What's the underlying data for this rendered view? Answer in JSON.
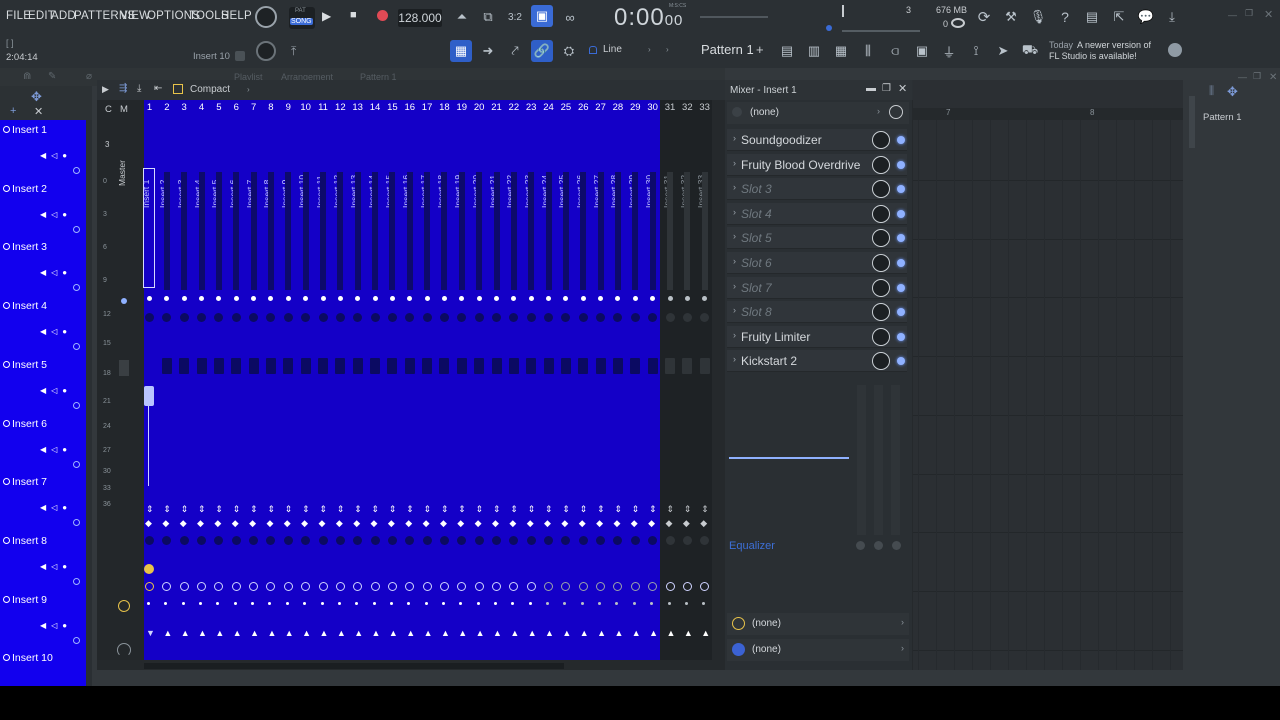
{
  "menu": [
    "FILE",
    "EDIT",
    "ADD",
    "PATTERNS",
    "VIEW",
    "OPTIONS",
    "TOOLS",
    "HELP"
  ],
  "transport": {
    "pat_label": "PAT",
    "song_label": "SONG",
    "tempo": "128.000",
    "time": "0:00",
    "time_frac": "00",
    "time_unit": "M:S:CS",
    "cpu_mem": "676 MB",
    "cpu_val": "3",
    "poly": "0",
    "position_hint": "2:04:14"
  },
  "toolbar": {
    "snap_label": "Line",
    "pattern_label": "Pattern 1",
    "pattern_add": "+",
    "news_date": "Today",
    "news_text": "A newer version of FL Studio is available!",
    "insert_hint": "Insert 10"
  },
  "playlist_tabs": {
    "playlist": "Playlist",
    "arrangement": "Arrangement",
    "pattern": "Pattern 1"
  },
  "inserts": [
    "Insert 1",
    "Insert 2",
    "Insert 3",
    "Insert 4",
    "Insert 5",
    "Insert 6",
    "Insert 7",
    "Insert 8",
    "Insert 9",
    "Insert 10"
  ],
  "mixer": {
    "view_mode": "Compact",
    "cm_labels": [
      "C",
      "M"
    ],
    "master_label": "Master",
    "master_num": "3",
    "channels": [
      "1",
      "2",
      "3",
      "4",
      "5",
      "6",
      "7",
      "8",
      "9",
      "10",
      "11",
      "12",
      "13",
      "14",
      "15",
      "16",
      "17",
      "18",
      "19",
      "20",
      "21",
      "22",
      "23",
      "24",
      "25",
      "26",
      "27",
      "28",
      "29",
      "30",
      "31",
      "32",
      "33"
    ],
    "channel_names": [
      "Insert 1",
      "Insert 2",
      "Insert 3",
      "Insert 4",
      "Insert 5",
      "Insert 6",
      "Insert 7",
      "Insert 8",
      "Insert 9",
      "Insert 10",
      "Insert 11",
      "Insert 12",
      "Insert 13",
      "Insert 14",
      "Insert 15",
      "Insert 16",
      "Insert 17",
      "Insert 18",
      "Insert 19",
      "Insert 20",
      "Insert 21",
      "Insert 22",
      "Insert 23",
      "Insert 24",
      "Insert 25",
      "Insert 26",
      "Insert 27",
      "Insert 28",
      "Insert 29",
      "Insert 30",
      "Insert 31",
      "Insert 32",
      "Insert 33"
    ],
    "db_scale": [
      "0",
      "3",
      "6",
      "9",
      "12",
      "15",
      "18",
      "21",
      "24",
      "27",
      "30",
      "33",
      "36"
    ]
  },
  "fx_panel": {
    "title": "Mixer - Insert 1",
    "input": "(none)",
    "slots": [
      {
        "name": "Soundgoodizer",
        "empty": false
      },
      {
        "name": "Fruity Blood Overdrive",
        "empty": false
      },
      {
        "name": "Slot 3",
        "empty": true
      },
      {
        "name": "Slot 4",
        "empty": true
      },
      {
        "name": "Slot 5",
        "empty": true
      },
      {
        "name": "Slot 6",
        "empty": true
      },
      {
        "name": "Slot 7",
        "empty": true
      },
      {
        "name": "Slot 8",
        "empty": true
      },
      {
        "name": "Fruity Limiter",
        "empty": false
      },
      {
        "name": "Kickstart 2",
        "empty": false
      }
    ],
    "eq_label": "Equalizer",
    "output_1": "(none)",
    "output_2": "(none)"
  },
  "playlist": {
    "bar_7": "7",
    "bar_8": "8",
    "pattern_tab": "Pattern 1"
  },
  "colors": {
    "accent_blue": "#1400c7",
    "insert_panel": "#1200ee",
    "toolbar": "#2b3034"
  }
}
